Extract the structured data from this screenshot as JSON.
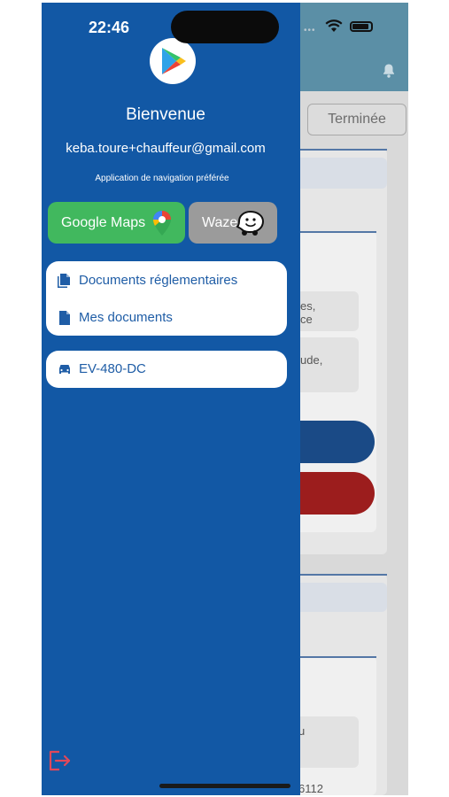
{
  "status_bar": {
    "time": "22:46"
  },
  "background_app": {
    "tab_terminee": "Terminée",
    "fragments": [
      "es,\nce",
      "ude,",
      "u",
      "6112"
    ]
  },
  "drawer": {
    "welcome": "Bienvenue",
    "email": "keba.toure+chauffeur@gmail.com",
    "nav_app_label": "Application de navigation préférée",
    "nav_buttons": {
      "google_maps": "Google Maps",
      "waze": "Waze"
    },
    "menu": {
      "documents_reglementaires": "Documents réglementaires",
      "mes_documents": "Mes documents"
    },
    "vehicle_plate": "EV-480-DC"
  },
  "icons": {
    "logo": "play-store-icon",
    "docs_regl": "documents-icon",
    "mes_docs": "document-icon",
    "vehicle": "car-icon",
    "logout": "logout-icon",
    "notification": "bell-icon"
  },
  "colors": {
    "drawer_bg": "#1258a5",
    "google_maps_btn": "#41b85e",
    "waze_btn": "#9b9b9b",
    "menu_text": "#1f5da6",
    "logout": "#e0485a"
  }
}
